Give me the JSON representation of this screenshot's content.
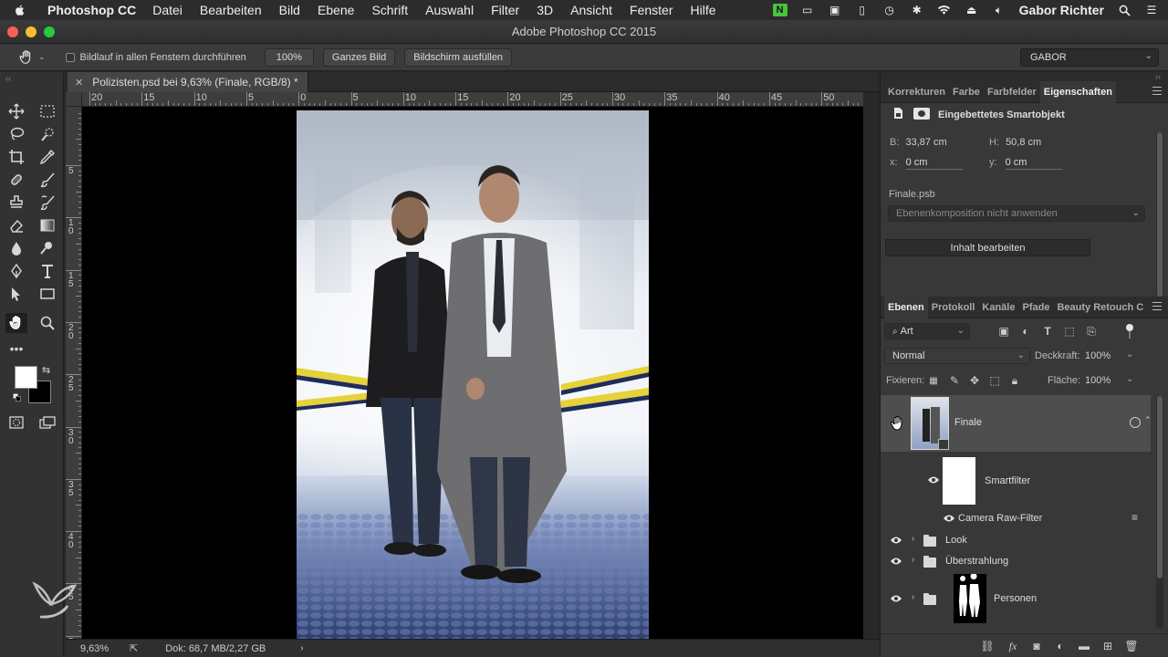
{
  "menubar": {
    "app_name": "Photoshop CC",
    "items": [
      "Datei",
      "Bearbeiten",
      "Bild",
      "Ebene",
      "Schrift",
      "Auswahl",
      "Filter",
      "3D",
      "Ansicht",
      "Fenster",
      "Hilfe"
    ],
    "user": "Gabor Richter"
  },
  "window": {
    "title": "Adobe Photoshop CC 2015"
  },
  "options": {
    "scroll_all_label": "Bildlauf in allen Fenstern durchführen",
    "zoom_btn": "100%",
    "fit_btn": "Ganzes Bild",
    "fill_btn": "Bildschirm ausfüllen",
    "workspace": "GABOR"
  },
  "document": {
    "tab_title": "Polizisten.psd bei 9,63% (Finale, RGB/8) *",
    "zoom": "9,63%",
    "doc_size": "Dok: 68,7 MB/2,27 GB"
  },
  "rulers": {
    "h_labels": [
      "20",
      "15",
      "10",
      "5",
      "0",
      "5",
      "10",
      "15",
      "20",
      "25",
      "30",
      "35",
      "40",
      "45",
      "50"
    ],
    "v_labels": [
      "5",
      "1\n0",
      "1\n5",
      "2\n0",
      "2\n5",
      "3\n0",
      "3\n5",
      "4\n0",
      "4\n5",
      "5"
    ]
  },
  "properties_panel": {
    "tabs": [
      "Korrekturen",
      "Farbe",
      "Farbfelder",
      "Eigenschaften"
    ],
    "active_tab": "Eigenschaften",
    "object_type": "Eingebettetes Smartobjekt",
    "b_label": "B:",
    "b_value": "33,87 cm",
    "h_label": "H:",
    "h_value": "50,8 cm",
    "x_label": "x:",
    "x_value": "0 cm",
    "y_label": "y:",
    "y_value": "0 cm",
    "file_name": "Finale.psb",
    "comp_select": "Ebenenkomposition nicht anwenden",
    "edit_button": "Inhalt bearbeiten"
  },
  "layers_panel": {
    "tabs": [
      "Ebenen",
      "Protokoll",
      "Kanäle",
      "Pfade",
      "Beauty Retouch C"
    ],
    "active_tab": "Ebenen",
    "filter_kind": "Art",
    "blend_mode": "Normal",
    "opacity_label": "Deckkraft:",
    "opacity": "100%",
    "lock_label": "Fixieren:",
    "fill_label": "Fläche:",
    "fill": "100%",
    "layers": [
      {
        "name": "Finale"
      },
      {
        "name": "Smartfilter"
      },
      {
        "name": "Camera Raw-Filter"
      },
      {
        "name": "Look"
      },
      {
        "name": "Überstrahlung"
      },
      {
        "name": "Personen"
      }
    ]
  },
  "colors": {
    "accent_green": "#49c43b",
    "tape_yellow": "#e6d23a",
    "tape_navy": "#1f2d5c"
  }
}
